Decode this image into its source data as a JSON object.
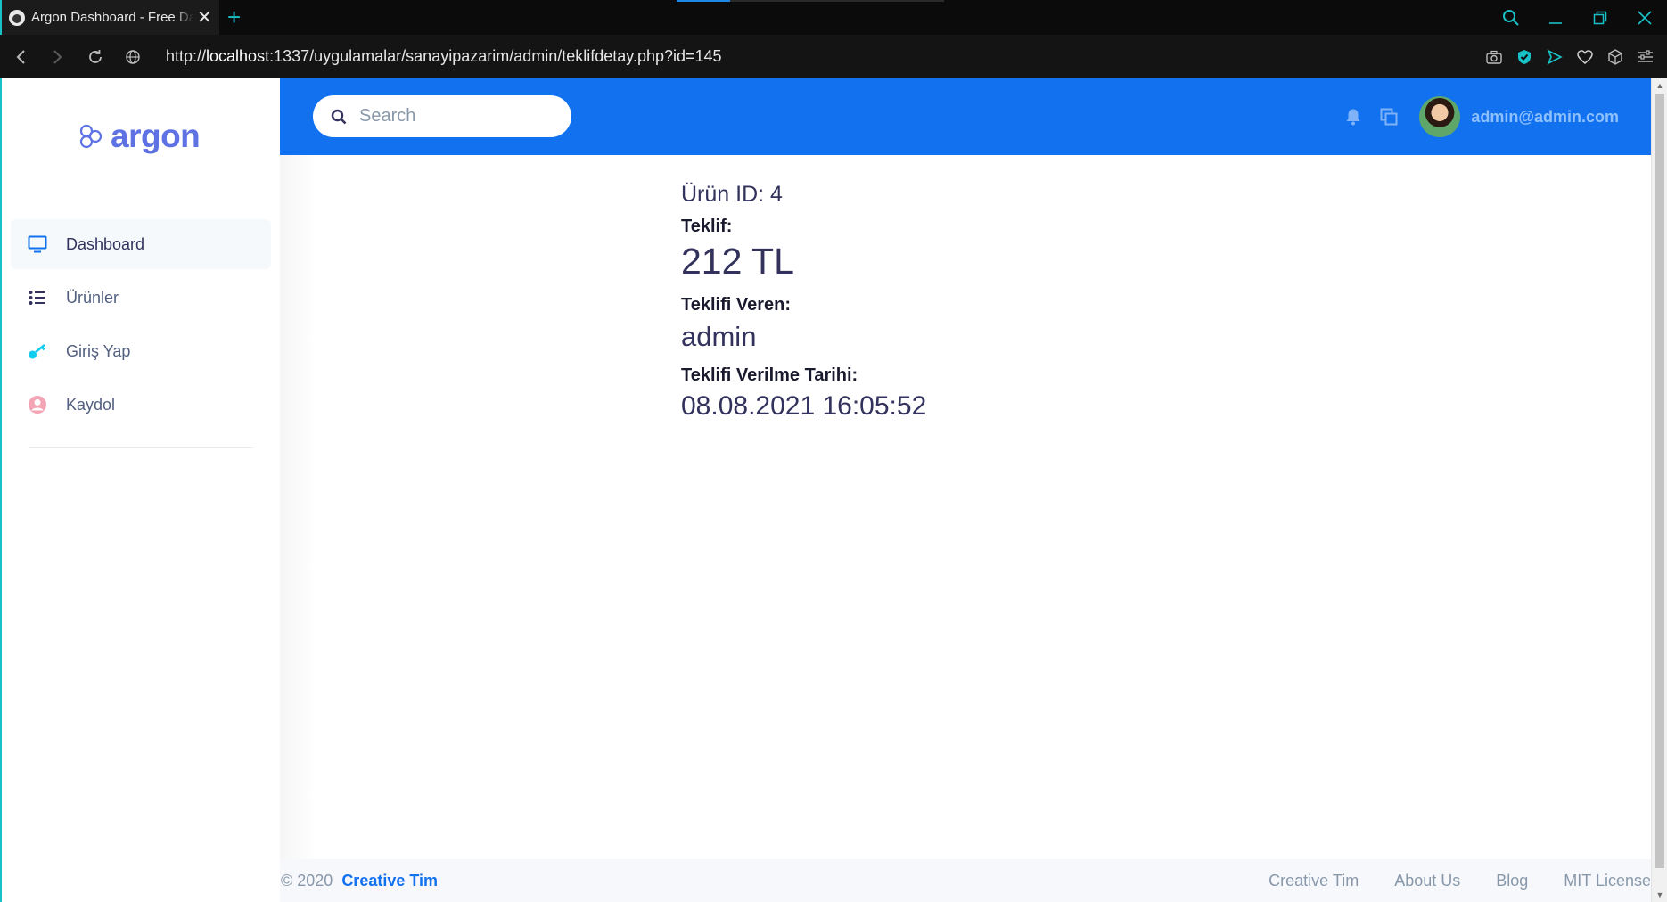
{
  "browser": {
    "tab_title": "Argon Dashboard - Free Dashboard",
    "new_tab": "+",
    "close_tab": "✕",
    "url_prefix": "http://",
    "url_host": "localhost",
    "url_rest": ":1337/uygulamalar/sanayipazarim/admin/teklifdetay.php?id=145",
    "accent": "#19c1c7"
  },
  "sidebar": {
    "brand": "argon",
    "items": [
      {
        "label": "Dashboard",
        "icon": "monitor-icon",
        "color": "#1171ef",
        "active": true
      },
      {
        "label": "Ürünler",
        "icon": "list-icon",
        "color": "#32325d",
        "active": false
      },
      {
        "label": "Giriş Yap",
        "icon": "key-icon",
        "color": "#11cdef",
        "active": false
      },
      {
        "label": "Kaydol",
        "icon": "user-circle-icon",
        "color": "#f3a4b5",
        "active": false
      }
    ]
  },
  "topbar": {
    "search_placeholder": "Search",
    "user_email": "admin@admin.com",
    "background": "#1171ef"
  },
  "detail": {
    "product_id": "Ürün ID: 4",
    "offer_label": "Teklif:",
    "offer_value": "212 TL",
    "offerer_label": "Teklifi Veren:",
    "offerer_value": "admin",
    "date_label": "Teklifi Verilme Tarihi:",
    "date_value": "08.08.2021 16:05:52"
  },
  "footer": {
    "copyright": "© 2020",
    "author_link": "Creative Tim",
    "links": [
      "Creative Tim",
      "About Us",
      "Blog",
      "MIT License"
    ]
  }
}
